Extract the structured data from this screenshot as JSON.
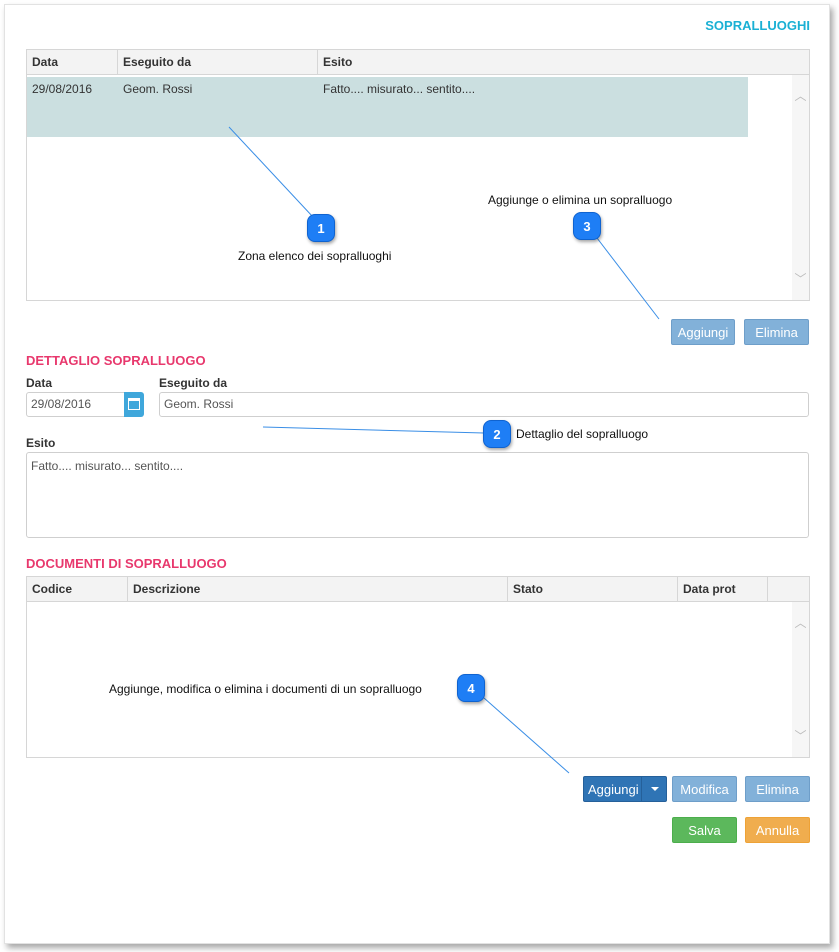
{
  "sopralluoghi": {
    "title": "SOPRALLUOGHI",
    "columns": [
      "Data",
      "Eseguito da",
      "Esito"
    ],
    "rows": [
      {
        "data": "29/08/2016",
        "eseguito_da": "Geom. Rossi",
        "esito": "Fatto.... misurato... sentito...."
      }
    ],
    "add_label": "Aggiungi",
    "delete_label": "Elimina"
  },
  "dettaglio": {
    "title": "DETTAGLIO SOPRALLUOGO",
    "data_label": "Data",
    "data_value": "29/08/2016",
    "eseguito_label": "Eseguito da",
    "eseguito_value": "Geom. Rossi",
    "esito_label": "Esito",
    "esito_value": "Fatto.... misurato... sentito...."
  },
  "documenti": {
    "title": "DOCUMENTI DI SOPRALLUOGO",
    "columns": [
      "Codice",
      "Descrizione",
      "Stato",
      "Data prot"
    ],
    "add_label": "Aggiungi",
    "edit_label": "Modifica",
    "delete_label": "Elimina"
  },
  "footer": {
    "save_label": "Salva",
    "cancel_label": "Annulla"
  },
  "annotations": {
    "c1": {
      "num": "1",
      "text": "Zona elenco dei sopralluoghi"
    },
    "c2": {
      "num": "2",
      "text": "Dettaglio del sopralluogo"
    },
    "c3": {
      "num": "3",
      "text": "Aggiunge o elimina un sopralluogo"
    },
    "c4": {
      "num": "4",
      "text": "Aggiunge, modifica o elimina i documenti di un sopralluogo"
    }
  },
  "colors": {
    "accent_blue": "#1ab0d4",
    "section_pink": "#e8386d",
    "selected_row": "#cbdfe0",
    "callout": "#1e7ef5"
  }
}
